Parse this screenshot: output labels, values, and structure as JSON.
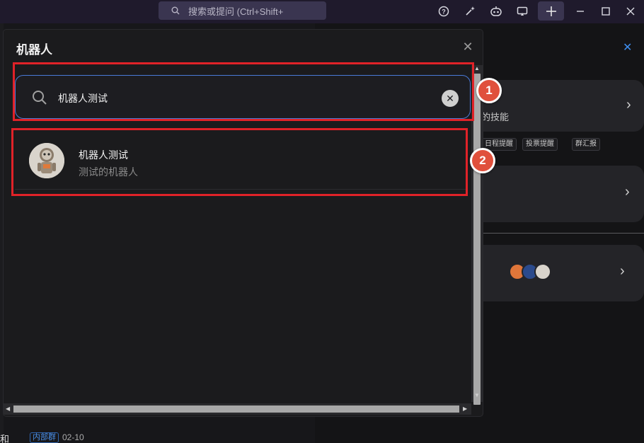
{
  "titlebar": {
    "search_placeholder": "搜索或提问 (Ctrl+Shift+",
    "icons": [
      "help-icon",
      "magic-wand-icon",
      "bot-icon",
      "screen-cast-icon",
      "plus-icon",
      "minimize-icon",
      "maximize-icon",
      "close-icon"
    ]
  },
  "dialog": {
    "title": "机器人",
    "search_value": "机器人测试",
    "results": [
      {
        "name": "机器人测试",
        "description": "测试的机器人"
      }
    ]
  },
  "background": {
    "card1_text": "的技能",
    "tags": [
      "日程提醒",
      "投票提醒",
      "群汇报"
    ],
    "bottom_tag": "内部群",
    "bottom_date": "02-10",
    "bottom_text": "和"
  },
  "annotations": {
    "badge1": "1",
    "badge2": "2",
    "color": "#e02228"
  }
}
